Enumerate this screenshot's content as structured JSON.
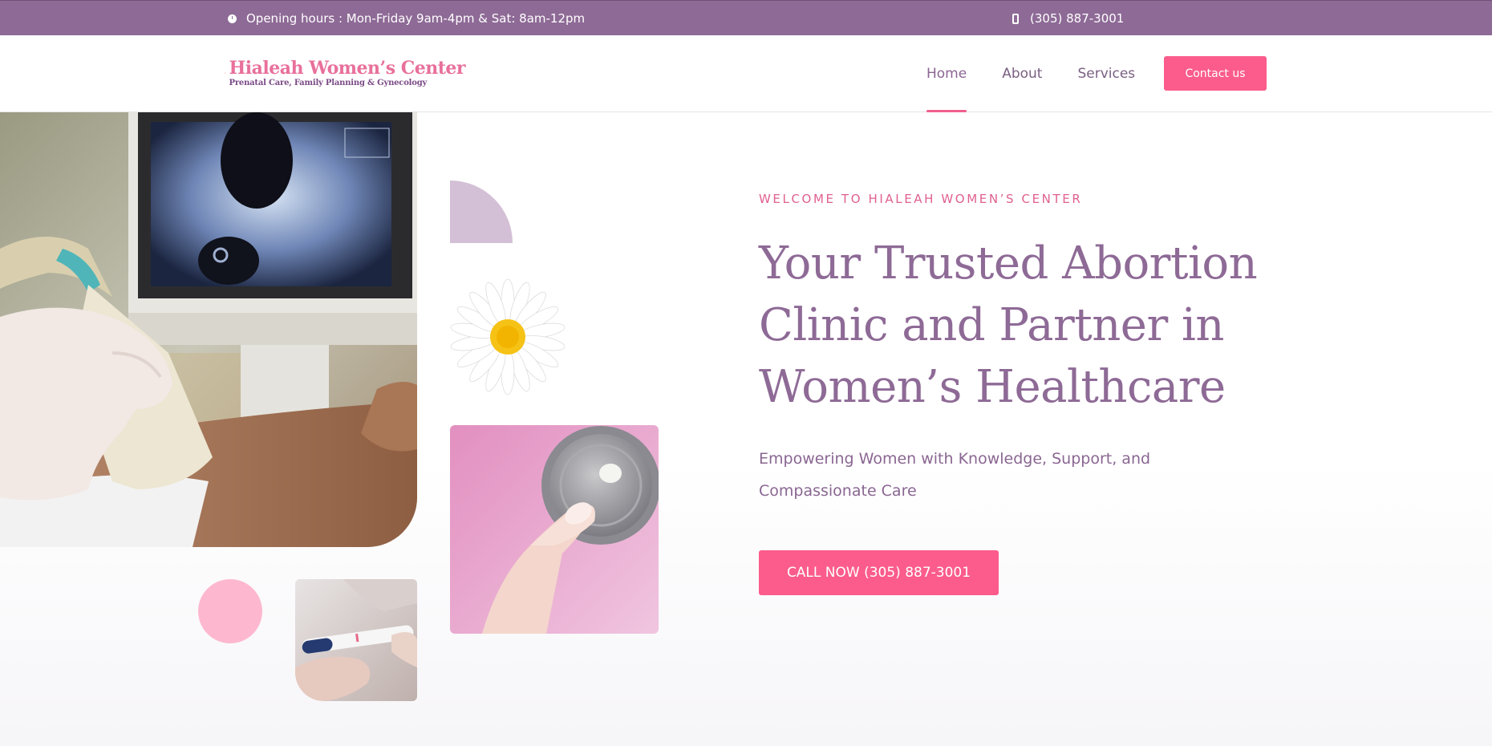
{
  "topbar": {
    "hours_text": "Opening hours : Mon-Friday 9am-4pm & Sat: 8am-12pm",
    "phone_text": "(305) 887-3001",
    "hours_icon": "clock-icon",
    "phone_icon": "mobile-phone-icon"
  },
  "logo": {
    "title": "Hialeah Women’s Center",
    "subtitle": "Prenatal Care, Family Planning & Gynecology"
  },
  "nav": {
    "items": [
      {
        "label": "Home",
        "active": true
      },
      {
        "label": "About",
        "active": false
      },
      {
        "label": "Services",
        "active": false
      }
    ],
    "contact_label": "Contact us"
  },
  "hero": {
    "eyebrow": "WELCOME TO HIALEAH WOMEN’S CENTER",
    "headline": "Your Trusted Abortion Clinic and Partner in Women’s Healthcare",
    "subline": "Empowering Women with Knowledge, Support, and Compassionate Care",
    "cta_label": "CALL NOW (305) 887-3001"
  },
  "colors": {
    "topbar_bg": "#8e6a96",
    "accent_pink": "#fb5c8c",
    "heading_purple": "#8e6a96",
    "eyebrow_pink": "#e06090",
    "quarter_circle": "#d3bfd6",
    "pink_dot": "#fdb8cf"
  }
}
